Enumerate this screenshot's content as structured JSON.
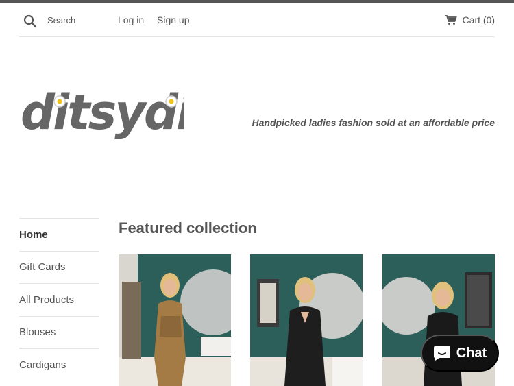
{
  "header": {
    "search_placeholder": "Search",
    "login_label": "Log in",
    "signup_label": "Sign up",
    "cart_label": "Cart (0)"
  },
  "brand": {
    "logo_text": "ditsydi",
    "tagline": "Handpicked ladies fashion sold at an affordable price"
  },
  "sidebar": {
    "items": [
      {
        "label": "Home",
        "active": true
      },
      {
        "label": "Gift Cards"
      },
      {
        "label": "All Products"
      },
      {
        "label": "Blouses"
      },
      {
        "label": "Cardigans"
      }
    ]
  },
  "main": {
    "featured_title": "Featured collection"
  },
  "chat": {
    "label": "Chat"
  },
  "colors": {
    "top_bar": "#555555",
    "text": "#555555",
    "wall_teal": "#2c5e5a",
    "chat_bg": "#111111"
  }
}
